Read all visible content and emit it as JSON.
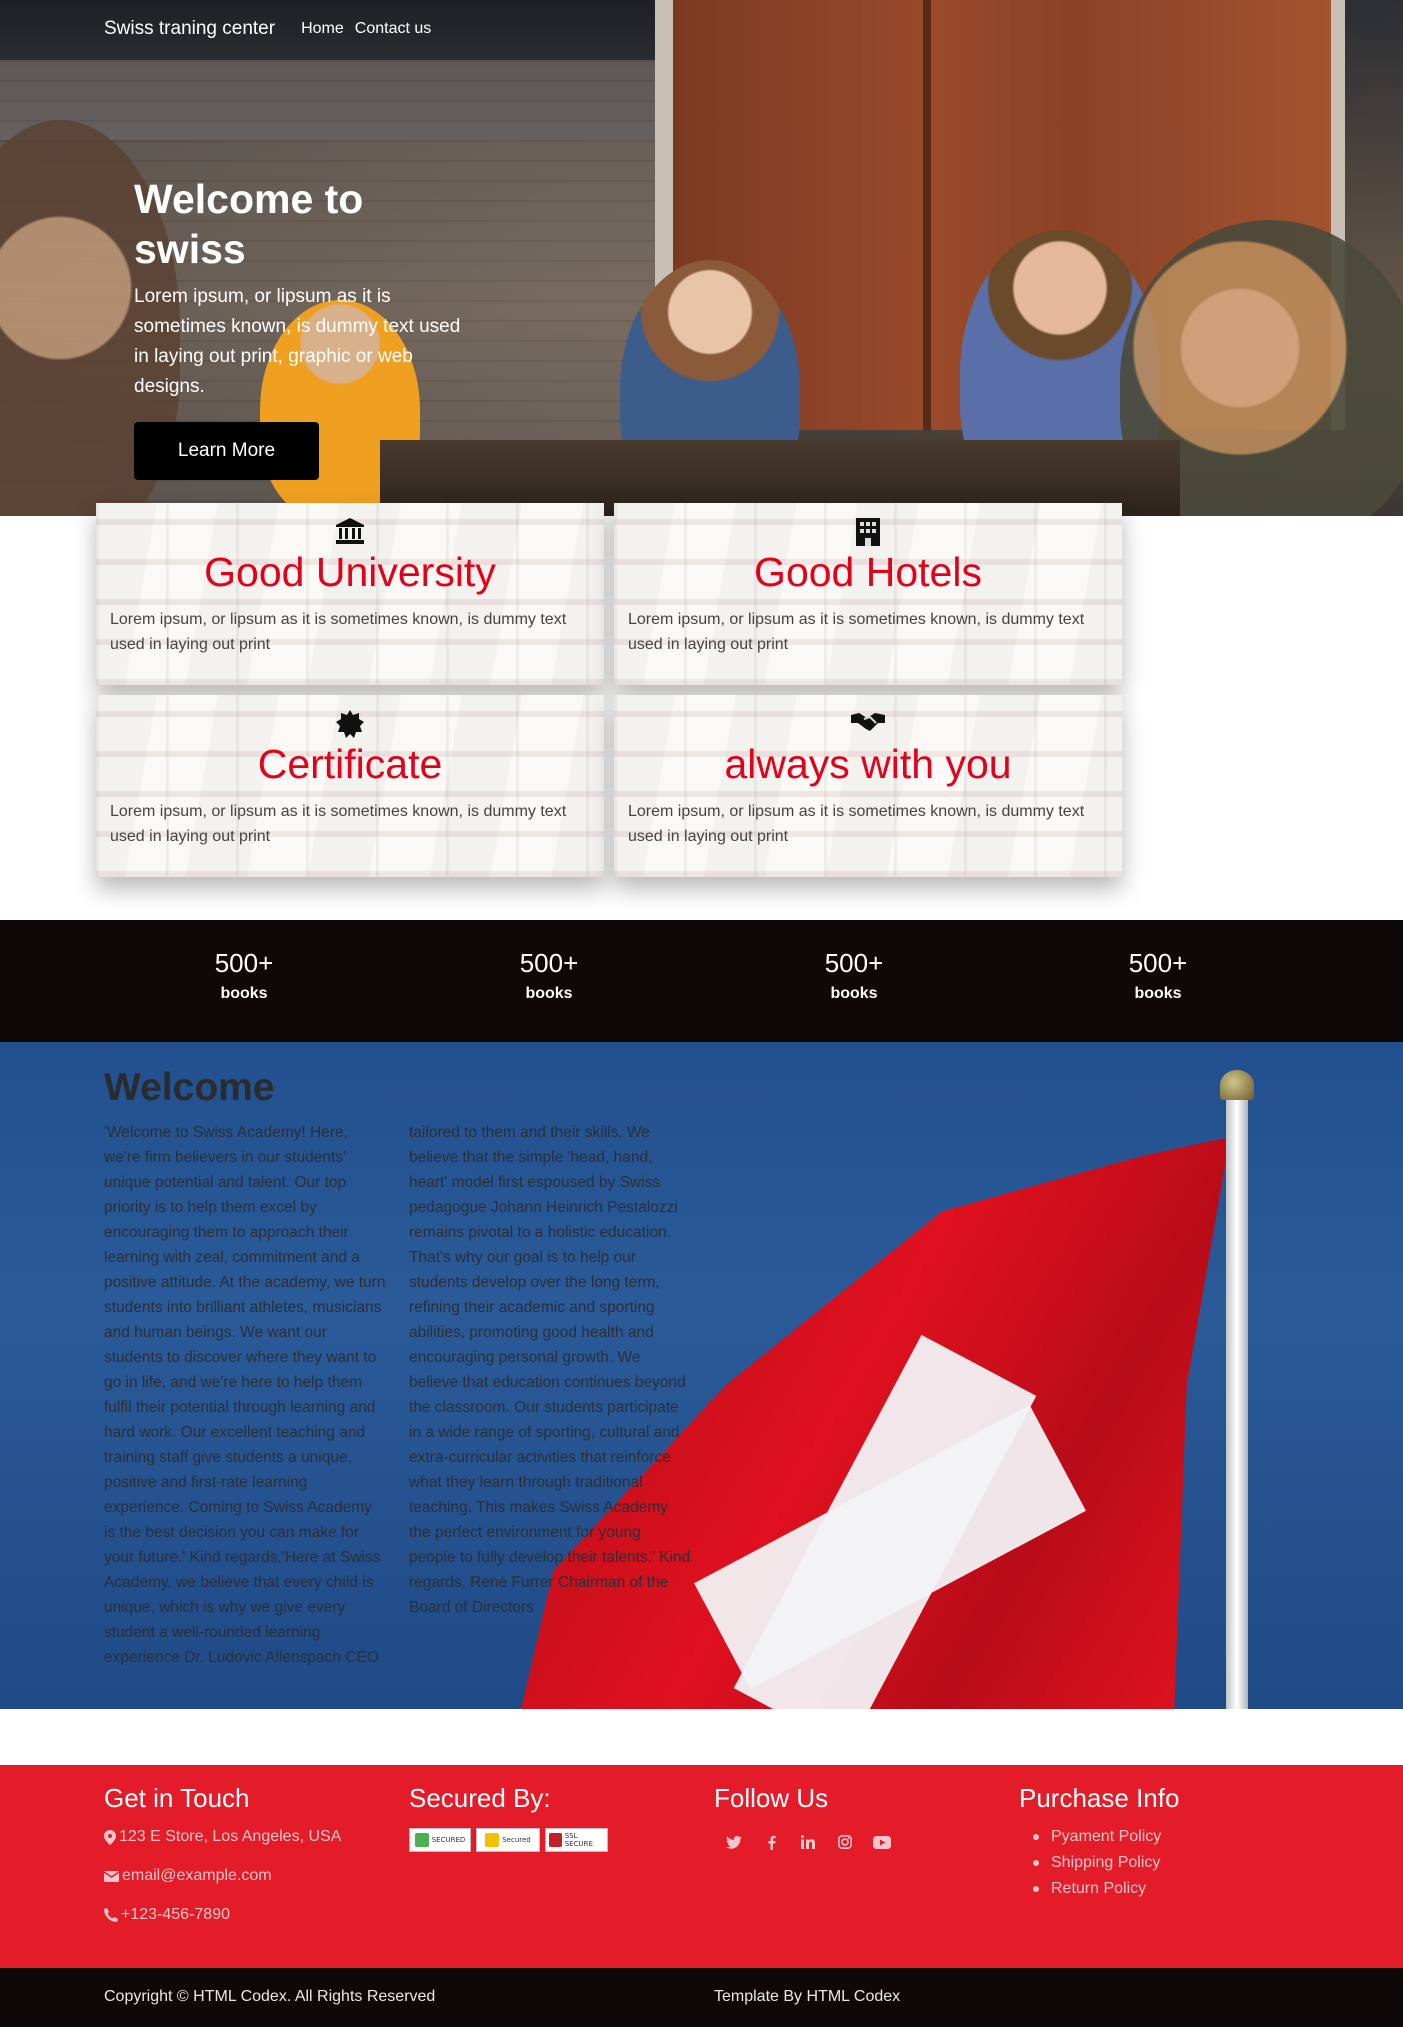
{
  "nav": {
    "brand": "Swiss traning center",
    "links": [
      "Home",
      "Contact us"
    ]
  },
  "hero": {
    "title": "Welcome to swiss",
    "subtitle": "Lorem ipsum, or lipsum as it is sometimes known, is dummy text used in laying out print, graphic or web designs.",
    "button": "Learn More"
  },
  "features": [
    {
      "icon": "university-icon",
      "title": "Good University",
      "desc": "Lorem ipsum, or lipsum as it is sometimes known, is dummy text used in laying out print"
    },
    {
      "icon": "hotel-icon",
      "title": "Good Hotels",
      "desc": "Lorem ipsum, or lipsum as it is sometimes known, is dummy text used in laying out print"
    },
    {
      "icon": "certificate-icon",
      "title": "Certificate",
      "desc": "Lorem ipsum, or lipsum as it is sometimes known, is dummy text used in laying out print"
    },
    {
      "icon": "handshake-icon",
      "title": "always with you",
      "desc": "Lorem ipsum, or lipsum as it is sometimes known, is dummy text used in laying out print"
    }
  ],
  "stats": [
    {
      "value": "500+",
      "label": "books"
    },
    {
      "value": "500+",
      "label": "books"
    },
    {
      "value": "500+",
      "label": "books"
    },
    {
      "value": "500+",
      "label": "books"
    }
  ],
  "welcome": {
    "title": "Welcome",
    "col1": "'Welcome to Swiss Academy! Here, we're firm believers in our students' unique potential and talent. Our top priority is to help them excel by encouraging them to approach their learning with zeal, commitment and a positive attitude. At the academy, we turn students into brilliant athletes, musicians and human beings. We want our students to discover where they want to go in life, and we're here to help them fulfil their potential through learning and hard work. Our excellent teaching and training staff give students a unique, positive and first-rate learning experience. Coming to Swiss Academy is the best decision you can make for your future.' Kind regards,'Here at Swiss Academy, we believe that every child is unique, which is why we give every student a well-rounded learning experience Dr. Ludovic Allenspach CEO",
    "col2": "tailored to them and their skills. We believe that the simple 'head, hand, heart' model first espoused by Swiss pedagogue Johann Heinrich Pestalozzi remains pivotal to a holistic education. That's why our goal is to help our students develop over the long term, refining their academic and sporting abilities, promoting good health and encouraging personal growth. We believe that education continues beyond the classroom. Our students participate in a wide range of sporting, cultural and extra-curricular activities that reinforce what they learn through traditional teaching. This makes Swiss Academy the perfect environment for young people to fully develop their talents.' Kind regards, René Furrer Chairman of the Board of Directors"
  },
  "footer": {
    "contact": {
      "heading": "Get in Touch",
      "address": "123 E Store, Los Angeles, USA",
      "email": "email@example.com",
      "phone": "+123-456-7890"
    },
    "secured": {
      "heading": "Secured By:",
      "seals": [
        "SECURED",
        "Secured",
        "SSL SECURE"
      ]
    },
    "follow": {
      "heading": "Follow Us",
      "icons": [
        "twitter-icon",
        "facebook-icon",
        "linkedin-icon",
        "instagram-icon",
        "youtube-icon"
      ]
    },
    "purchase": {
      "heading": "Purchase Info",
      "items": [
        "Pyament Policy",
        "Shipping Policy",
        "Return Policy"
      ]
    }
  },
  "copyright": {
    "left": "Copyright © HTML Codex. All Rights Reserved",
    "right": "Template By HTML Codex"
  },
  "colors": {
    "accent": "#e41b28",
    "card_title": "#e3001b",
    "dark": "#0e0808"
  }
}
